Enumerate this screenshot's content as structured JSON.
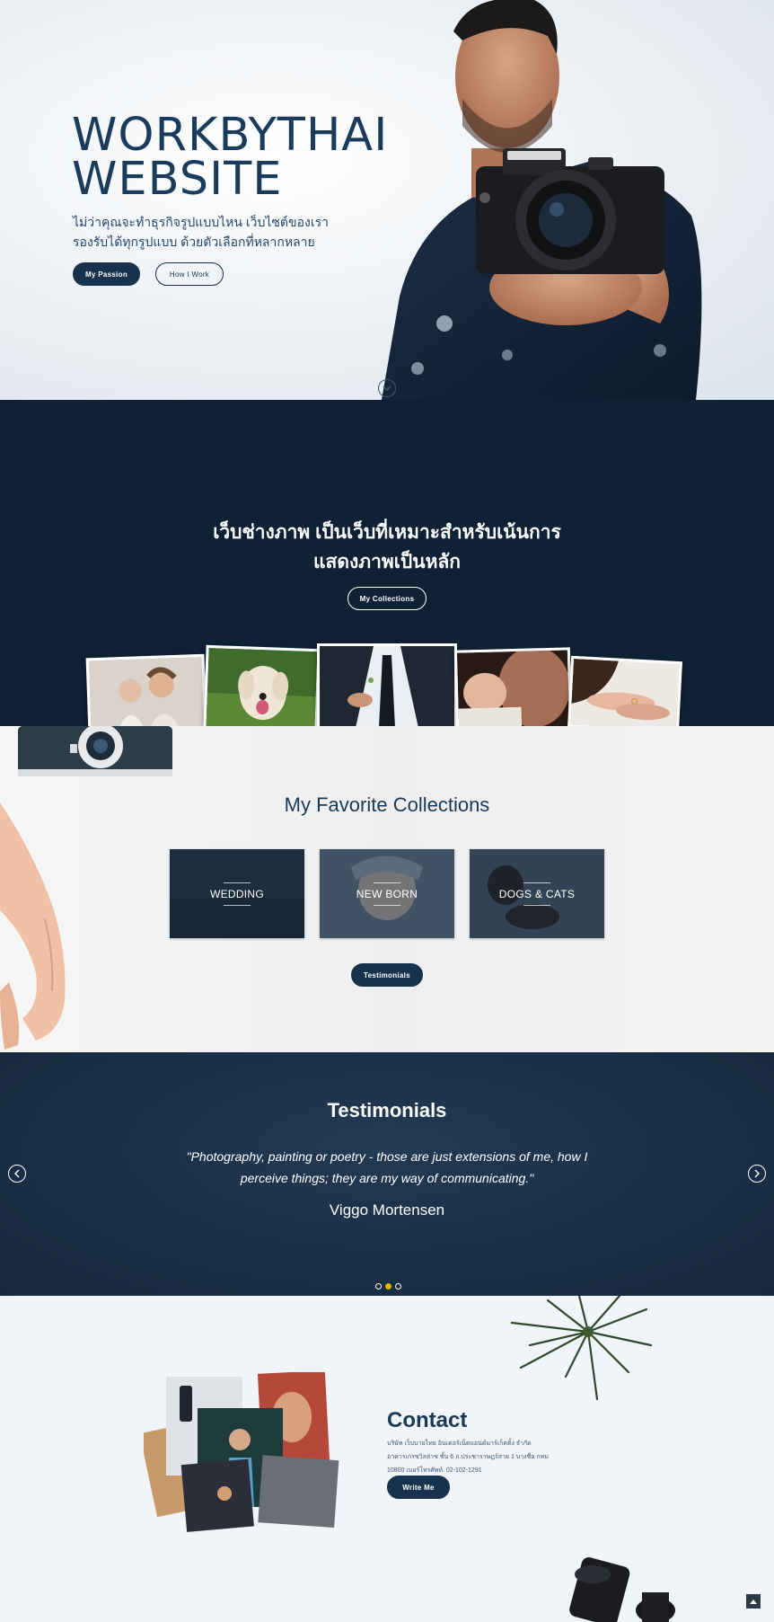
{
  "hero": {
    "title_line1": "WORKBYTHAI",
    "title_line2": "WEBSITE",
    "subtitle_line1": "ไม่ว่าคุณจะทำธุรกิจรูปแบบไหน เว็บไซต์ของเรา",
    "subtitle_line2": "รองรับได้ทุกรูปแบบ ด้วยตัวเลือกที่หลากหลาย",
    "primary_button": "My Passion",
    "secondary_button": "How I Work"
  },
  "intro": {
    "title_line1": "เว็บช่างภาพ เป็นเว็บที่เหมาะสำหรับเน้นการ",
    "title_line2": "แสดงภาพเป็นหลัก",
    "button": "My Collections"
  },
  "collections": {
    "title": "My Favorite Collections",
    "cards": [
      {
        "label": "WEDDING"
      },
      {
        "label": "NEW BORN"
      },
      {
        "label": "DOGS & CATS"
      }
    ],
    "button": "Testimonials"
  },
  "testimonials": {
    "title": "Testimonials",
    "quote_line1": "\"Photography, painting or poetry - those are just extensions of me, how I",
    "quote_line2": "perceive things; they are my way of communicating.\"",
    "author": "Viggo Mortensen",
    "active_slide": 2,
    "slide_count": 3
  },
  "contact": {
    "title": "Contact",
    "line1": "บริษัท เว็บบายไทย อินเตอร์เน็ตแอนด์มาร์เก็ตติ้ง จำกัด",
    "line2": "อาคารเกรซวิลล่าช ชั้น 6 ถ.ประชาราษฎร์สาย 1 บางซื่อ กทม",
    "line3": "10800 เบอร์โทรศัพท์. 02-102-1291",
    "button": "Write Me"
  },
  "colors": {
    "navy": "#17324f",
    "dark_section": "#0e2135",
    "accent_dot": "#e4b600"
  }
}
